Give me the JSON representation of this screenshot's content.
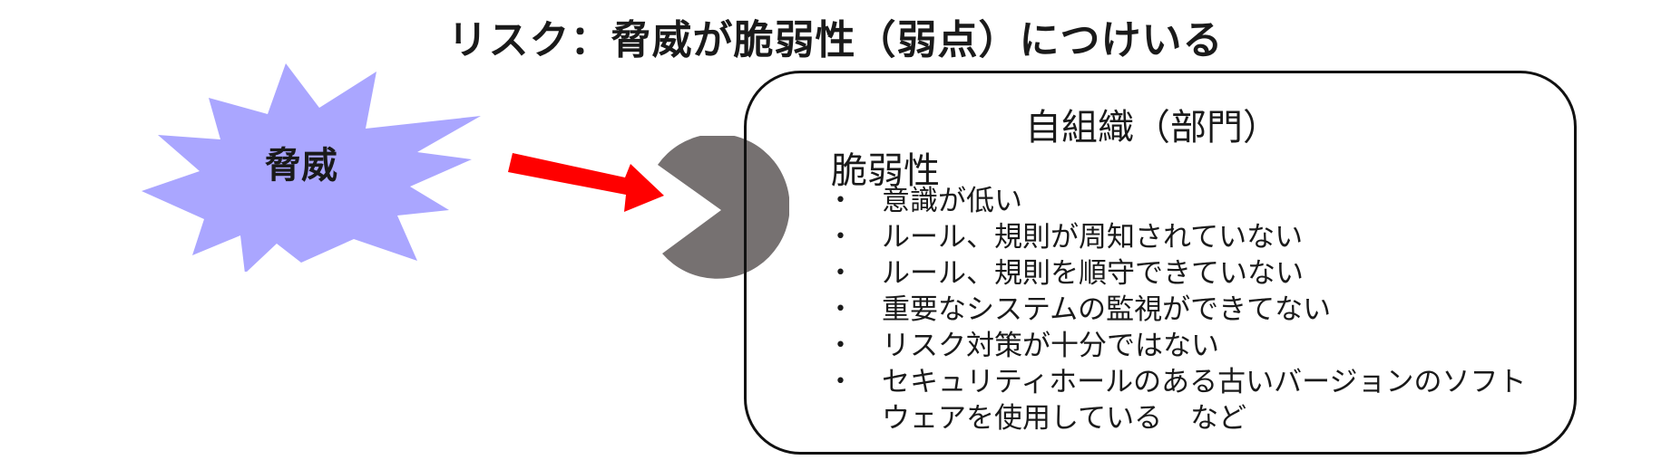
{
  "title": "リスク：脅威が脆弱性（弱点）につけいる",
  "threat": {
    "label": "脅威",
    "fill_color": "#aaa6ff"
  },
  "arrow": {
    "color": "#ff0000"
  },
  "attacker": {
    "fill_color": "#767171"
  },
  "organization": {
    "title": "自組織（部門）",
    "vulnerability_heading": "脆弱性",
    "bullet": "•",
    "items": [
      "意識が低い",
      "ルール、規則が周知されていない",
      "ルール、規則を順守できていない",
      "重要なシステムの監視ができてない",
      "リスク対策が十分ではない",
      "セキュリティホールのある古いバージョンのソフトウェアを使用している　など"
    ]
  }
}
